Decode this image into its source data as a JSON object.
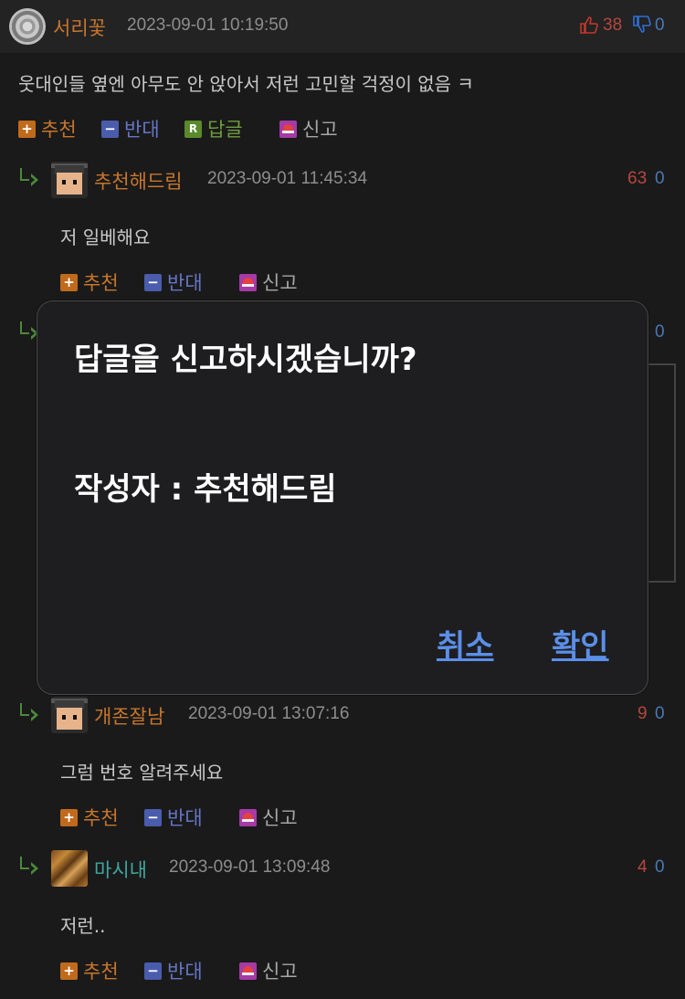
{
  "post": {
    "nick": "서리꽃",
    "date": "2023-09-01 10:19:50",
    "up": "38",
    "down": "0",
    "text": "웃대인들 옆엔 아무도 안 앉아서 저런 고민할 걱정이 없음 ㅋ",
    "actions": {
      "recommend": "추천",
      "oppose": "반대",
      "reply": "답글",
      "report": "신고"
    }
  },
  "replies": [
    {
      "nick": "추천해드림",
      "date": "2023-09-01 11:45:34",
      "up": "63",
      "down": "0",
      "text": "저 일베해요"
    },
    {
      "up": "",
      "down": "0"
    },
    {
      "nick": "개존잘남",
      "date": "2023-09-01 13:07:16",
      "up": "9",
      "down": "0",
      "text": "그럼 번호 알려주세요"
    },
    {
      "nick": "마시내",
      "date": "2023-09-01 13:09:48",
      "up": "4",
      "down": "0",
      "text": "저런.."
    }
  ],
  "reply_actions": {
    "recommend": "추천",
    "oppose": "반대",
    "report": "신고"
  },
  "dialog": {
    "title": "답글을 신고하시겠습니까?",
    "author": "작성자 : 추천해드림",
    "cancel": "취소",
    "confirm": "확인"
  },
  "colors": {
    "recommend": "#c7762c",
    "oppose": "#6576c6",
    "report": "#a63aa6",
    "link": "#5b8fe8"
  }
}
